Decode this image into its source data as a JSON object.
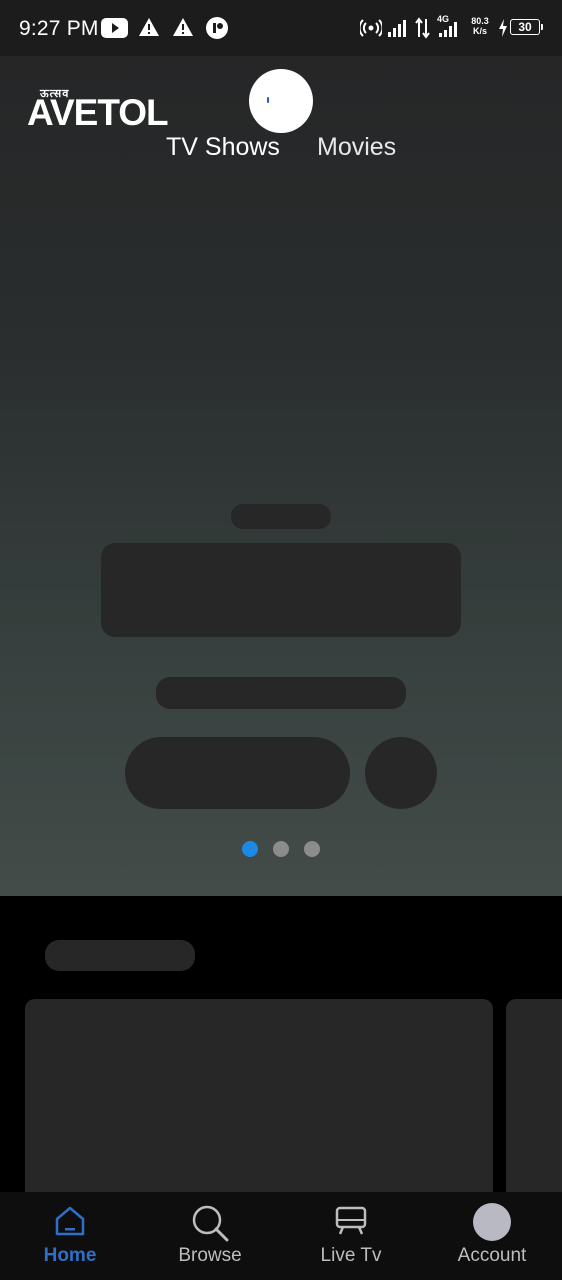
{
  "status_bar": {
    "time": "9:27 PM",
    "network_speed_value": "80.3",
    "network_speed_unit": "K/s",
    "network_type": "4G",
    "battery_level": "30"
  },
  "header": {
    "logo_top": "ऊत्सव",
    "logo_main": "AVETOL",
    "tabs": [
      {
        "label": "TV Shows",
        "active": true
      },
      {
        "label": "Movies",
        "active": false
      }
    ]
  },
  "carousel": {
    "page_count": 3,
    "active_index": 0,
    "active_color": "#1e88e5",
    "inactive_color": "#8c8c8c"
  },
  "bottom_nav": {
    "items": [
      {
        "label": "Home",
        "icon": "home-icon",
        "active": true
      },
      {
        "label": "Browse",
        "icon": "search-icon",
        "active": false
      },
      {
        "label": "Live Tv",
        "icon": "tv-icon",
        "active": false
      },
      {
        "label": "Account",
        "icon": "avatar-icon",
        "active": false
      }
    ],
    "active_color": "#2f6fc9"
  }
}
